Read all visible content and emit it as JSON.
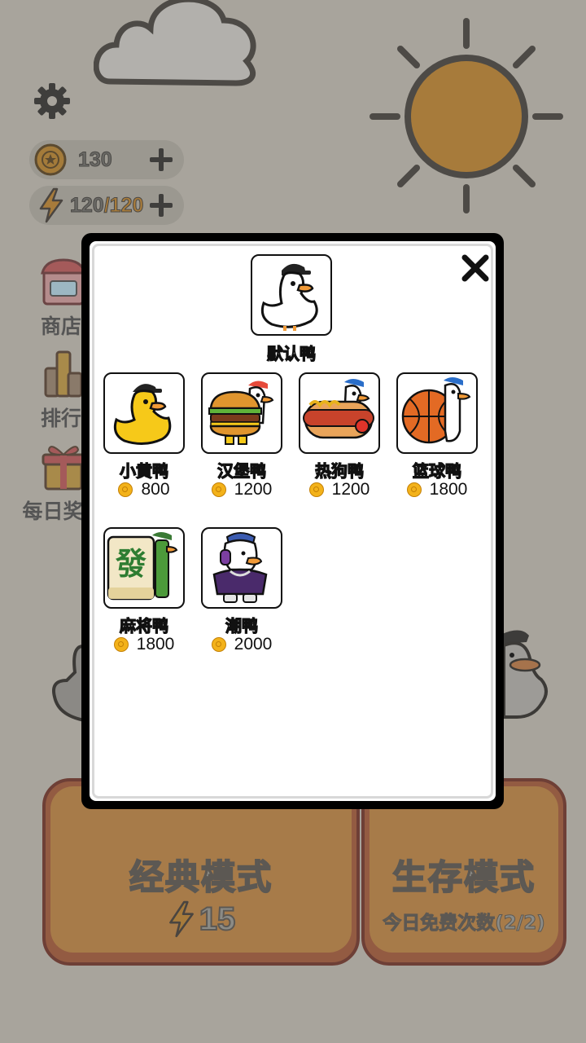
{
  "hud": {
    "coins": "130",
    "energy_current": "120",
    "energy_separator": "/",
    "energy_max": "120"
  },
  "side_menu": {
    "shop": "商店",
    "rank": "排行",
    "daily": "每日奖"
  },
  "modes": {
    "classic": {
      "title": "经典模式",
      "cost": "15"
    },
    "survival": {
      "title": "生存模式",
      "sub": "今日免费次数(2/2)"
    }
  },
  "skin_modal": {
    "current": "默认鸭",
    "skins": [
      {
        "name": "小黄鸭",
        "price": "800"
      },
      {
        "name": "汉堡鸭",
        "price": "1200"
      },
      {
        "name": "热狗鸭",
        "price": "1200"
      },
      {
        "name": "篮球鸭",
        "price": "1800"
      },
      {
        "name": "麻将鸭",
        "price": "1800"
      },
      {
        "name": "潮鸭",
        "price": "2000"
      }
    ]
  },
  "icons": {
    "settings": "gear-icon",
    "coin": "coin-icon",
    "energy": "lightning-icon",
    "close": "close-icon"
  },
  "colors": {
    "background": "#a8a49c",
    "mode_button": "#a77b49",
    "coin": "#f3b21a"
  }
}
